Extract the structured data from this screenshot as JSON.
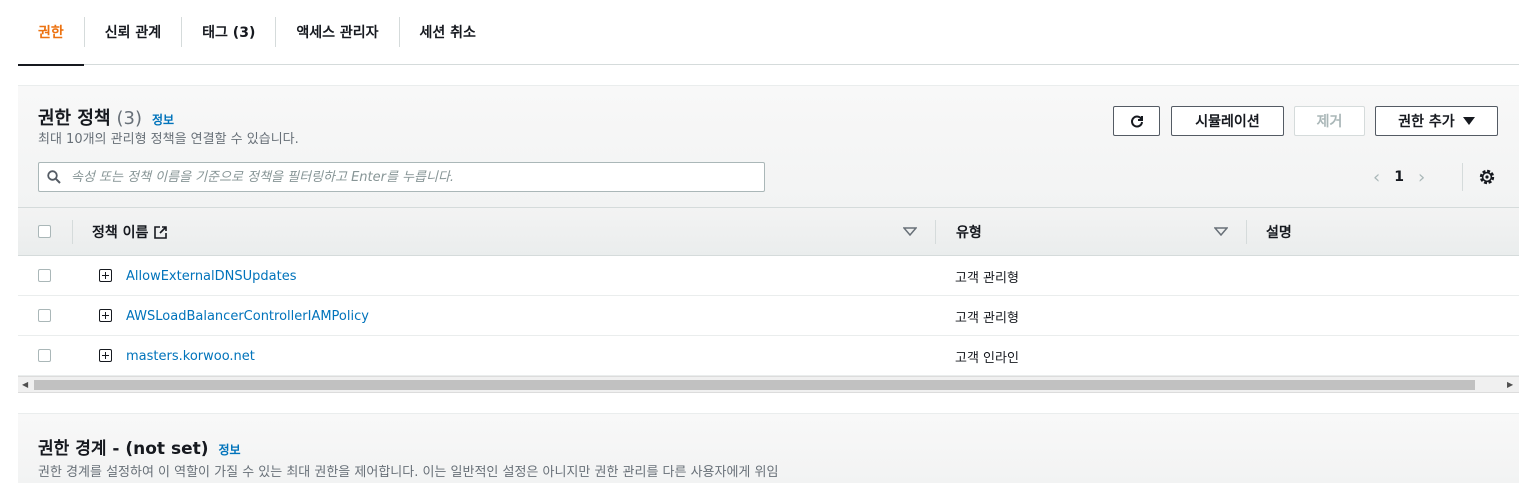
{
  "tabs": [
    {
      "label": "권한"
    },
    {
      "label": "신뢰 관계"
    },
    {
      "label": "태그 (3)"
    },
    {
      "label": "액세스 관리자"
    },
    {
      "label": "세션 취소"
    }
  ],
  "policies": {
    "title": "권한 정책",
    "count": "(3)",
    "info": "정보",
    "description": "최대 10개의 관리형 정책을 연결할 수 있습니다.",
    "buttons": {
      "refresh_icon": "refresh-icon",
      "simulate": "시뮬레이션",
      "remove": "제거",
      "add": "권한 추가"
    },
    "search_placeholder": "속성 또는 정책 이름을 기준으로 정책을 필터링하고 Enter를 누릅니다.",
    "page": "1",
    "columns": {
      "name": "정책 이름",
      "type": "유형",
      "description": "설명"
    },
    "rows": [
      {
        "name": "AllowExternalDNSUpdates",
        "type": "고객 관리형",
        "description": ""
      },
      {
        "name": "AWSLoadBalancerControllerIAMPolicy",
        "type": "고객 관리형",
        "description": ""
      },
      {
        "name": "masters.korwoo.net",
        "type": "고객 인라인",
        "description": ""
      }
    ]
  },
  "boundary": {
    "title": "권한 경계 - (not set)",
    "info": "정보",
    "description": "권한 경계를 설정하여 이 역할이 가질 수 있는 최대 권한을 제어합니다. 이는 일반적인 설정은 아니지만 권한 관리를 다른 사용자에게 위임"
  },
  "colors": {
    "accent": "#ec7211",
    "link": "#0073bb",
    "muted": "#687078"
  }
}
